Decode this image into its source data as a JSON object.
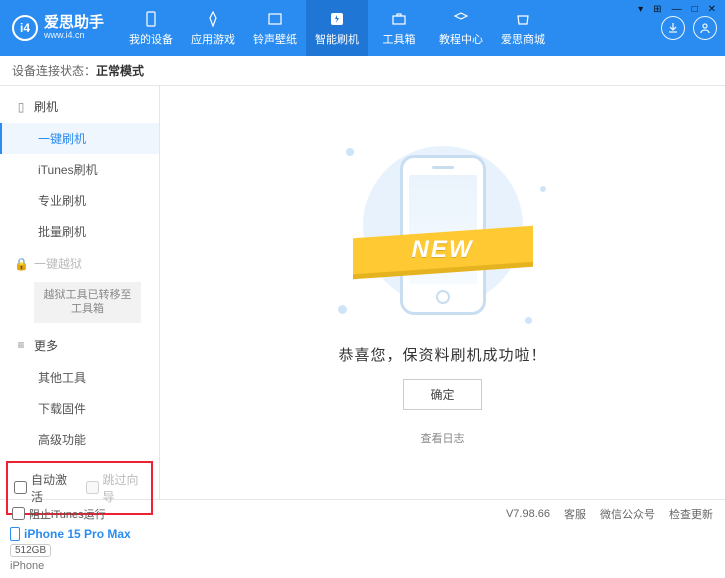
{
  "header": {
    "logo_text": "爱思助手",
    "logo_sub": "www.i4.cn",
    "nav": [
      {
        "label": "我的设备"
      },
      {
        "label": "应用游戏"
      },
      {
        "label": "铃声壁纸"
      },
      {
        "label": "智能刷机",
        "active": true
      },
      {
        "label": "工具箱"
      },
      {
        "label": "教程中心"
      },
      {
        "label": "爱思商城"
      }
    ]
  },
  "status": {
    "label": "设备连接状态：",
    "value": "正常模式"
  },
  "sidebar": {
    "groups": [
      {
        "title": "刷机",
        "subs": [
          {
            "label": "一键刷机",
            "active": true
          },
          {
            "label": "iTunes刷机"
          },
          {
            "label": "专业刷机"
          },
          {
            "label": "批量刷机"
          }
        ]
      },
      {
        "title": "一键越狱",
        "locked": true,
        "subs": [
          {
            "label": "越狱工具已转移至工具箱",
            "boxed": true
          }
        ]
      },
      {
        "title": "更多",
        "subs": [
          {
            "label": "其他工具"
          },
          {
            "label": "下载固件"
          },
          {
            "label": "高级功能"
          }
        ]
      }
    ],
    "checkbox1": "自动激活",
    "checkbox2": "跳过向导",
    "device": {
      "name": "iPhone 15 Pro Max",
      "storage": "512GB",
      "type": "iPhone"
    }
  },
  "main": {
    "ribbon": "NEW",
    "message": "恭喜您，保资料刷机成功啦！",
    "ok": "确定",
    "log": "查看日志"
  },
  "footer": {
    "block_itunes": "阻止iTunes运行",
    "version": "V7.98.66",
    "links": [
      "客服",
      "微信公众号",
      "检查更新"
    ]
  }
}
